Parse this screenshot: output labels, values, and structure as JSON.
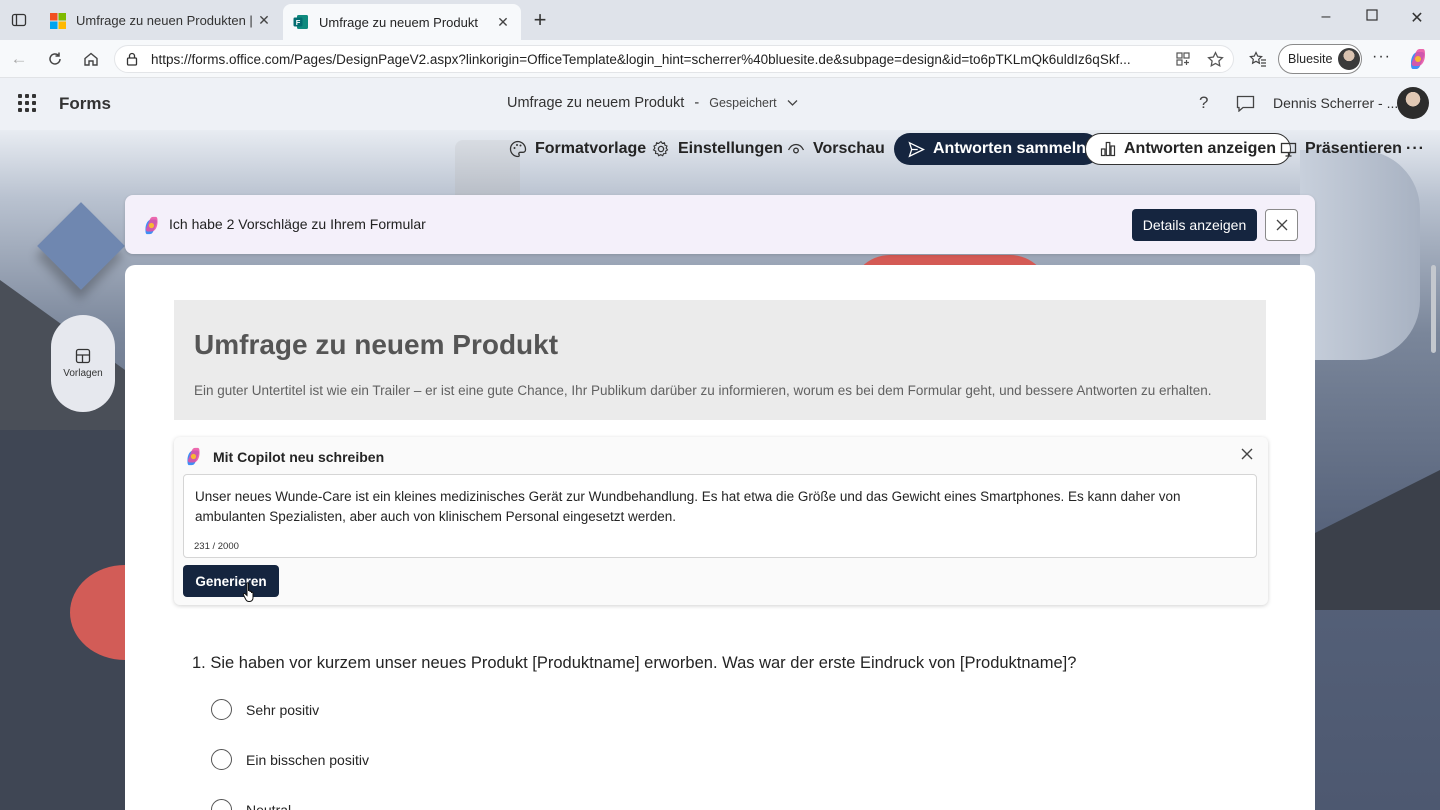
{
  "browser": {
    "tabs": [
      {
        "title": "Umfrage zu neuen Produkten | M",
        "active": false
      },
      {
        "title": "Umfrage zu neuem Produkt",
        "active": true
      }
    ],
    "url": "https://forms.office.com/Pages/DesignPageV2.aspx?linkorigin=OfficeTemplate&login_hint=scherrer%40bluesite.de&subpage=design&id=to6pTKLmQk6uldIz6qSkf...",
    "profile_label": "Bluesite"
  },
  "app": {
    "name": "Forms",
    "doc_title": "Umfrage zu neuem Produkt",
    "separator": "-",
    "save_status": "Gespeichert",
    "help_label": "?",
    "user_name": "Dennis Scherrer - ..."
  },
  "toolbar": {
    "formatvorlage": "Formatvorlage",
    "einstellungen": "Einstellungen",
    "vorschau": "Vorschau",
    "antworten_sammeln": "Antworten sammeln",
    "antworten_anzeigen": "Antworten anzeigen",
    "praesentieren": "Präsentieren"
  },
  "banner": {
    "text": "Ich habe 2 Vorschläge zu Ihrem Formular",
    "details_button": "Details anzeigen"
  },
  "sidebar": {
    "vorlagen_label": "Vorlagen"
  },
  "form": {
    "title": "Umfrage zu neuem Produkt",
    "subtitle": "Ein guter Untertitel ist wie ein Trailer – er ist eine gute Chance, Ihr Publikum darüber zu informieren, worum es bei dem Formular geht, und bessere Antworten zu erhalten."
  },
  "copilot": {
    "title": "Mit Copilot neu schreiben",
    "text": "Unser neues Wunde-Care ist ein kleines medizinisches Gerät zur Wundbehandlung. Es hat etwa die Größe und das Gewicht eines Smartphones. Es kann daher von ambulanten Spezialisten, aber auch von klinischem Personal eingesetzt werden.",
    "counter": "231 / 2000",
    "generate_button": "Generieren"
  },
  "question1": {
    "text": "1. Sie haben vor kurzem unser neues Produkt [Produktname] erworben. Was war der erste Eindruck von [Produktname]?",
    "options": [
      "Sehr positiv",
      "Ein bisschen positiv",
      "Neutral"
    ]
  },
  "colors": {
    "primary_dark": "#15253f",
    "banner_bg": "#f4f0fa",
    "accent_red": "#d45a55"
  }
}
